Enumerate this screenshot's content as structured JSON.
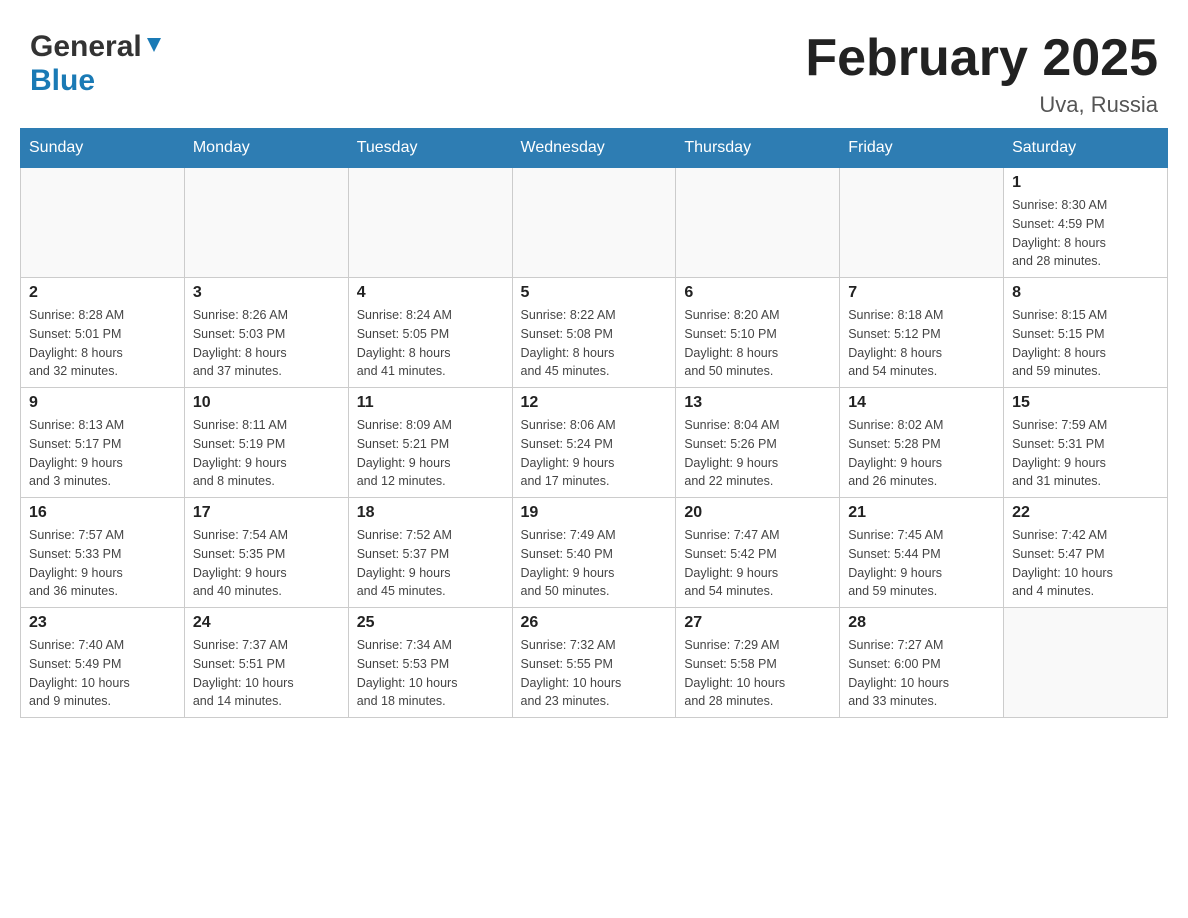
{
  "header": {
    "logo_general": "General",
    "logo_blue": "Blue",
    "title": "February 2025",
    "subtitle": "Uva, Russia"
  },
  "days_of_week": [
    "Sunday",
    "Monday",
    "Tuesday",
    "Wednesday",
    "Thursday",
    "Friday",
    "Saturday"
  ],
  "weeks": [
    [
      {
        "day": "",
        "info": ""
      },
      {
        "day": "",
        "info": ""
      },
      {
        "day": "",
        "info": ""
      },
      {
        "day": "",
        "info": ""
      },
      {
        "day": "",
        "info": ""
      },
      {
        "day": "",
        "info": ""
      },
      {
        "day": "1",
        "info": "Sunrise: 8:30 AM\nSunset: 4:59 PM\nDaylight: 8 hours\nand 28 minutes."
      }
    ],
    [
      {
        "day": "2",
        "info": "Sunrise: 8:28 AM\nSunset: 5:01 PM\nDaylight: 8 hours\nand 32 minutes."
      },
      {
        "day": "3",
        "info": "Sunrise: 8:26 AM\nSunset: 5:03 PM\nDaylight: 8 hours\nand 37 minutes."
      },
      {
        "day": "4",
        "info": "Sunrise: 8:24 AM\nSunset: 5:05 PM\nDaylight: 8 hours\nand 41 minutes."
      },
      {
        "day": "5",
        "info": "Sunrise: 8:22 AM\nSunset: 5:08 PM\nDaylight: 8 hours\nand 45 minutes."
      },
      {
        "day": "6",
        "info": "Sunrise: 8:20 AM\nSunset: 5:10 PM\nDaylight: 8 hours\nand 50 minutes."
      },
      {
        "day": "7",
        "info": "Sunrise: 8:18 AM\nSunset: 5:12 PM\nDaylight: 8 hours\nand 54 minutes."
      },
      {
        "day": "8",
        "info": "Sunrise: 8:15 AM\nSunset: 5:15 PM\nDaylight: 8 hours\nand 59 minutes."
      }
    ],
    [
      {
        "day": "9",
        "info": "Sunrise: 8:13 AM\nSunset: 5:17 PM\nDaylight: 9 hours\nand 3 minutes."
      },
      {
        "day": "10",
        "info": "Sunrise: 8:11 AM\nSunset: 5:19 PM\nDaylight: 9 hours\nand 8 minutes."
      },
      {
        "day": "11",
        "info": "Sunrise: 8:09 AM\nSunset: 5:21 PM\nDaylight: 9 hours\nand 12 minutes."
      },
      {
        "day": "12",
        "info": "Sunrise: 8:06 AM\nSunset: 5:24 PM\nDaylight: 9 hours\nand 17 minutes."
      },
      {
        "day": "13",
        "info": "Sunrise: 8:04 AM\nSunset: 5:26 PM\nDaylight: 9 hours\nand 22 minutes."
      },
      {
        "day": "14",
        "info": "Sunrise: 8:02 AM\nSunset: 5:28 PM\nDaylight: 9 hours\nand 26 minutes."
      },
      {
        "day": "15",
        "info": "Sunrise: 7:59 AM\nSunset: 5:31 PM\nDaylight: 9 hours\nand 31 minutes."
      }
    ],
    [
      {
        "day": "16",
        "info": "Sunrise: 7:57 AM\nSunset: 5:33 PM\nDaylight: 9 hours\nand 36 minutes."
      },
      {
        "day": "17",
        "info": "Sunrise: 7:54 AM\nSunset: 5:35 PM\nDaylight: 9 hours\nand 40 minutes."
      },
      {
        "day": "18",
        "info": "Sunrise: 7:52 AM\nSunset: 5:37 PM\nDaylight: 9 hours\nand 45 minutes."
      },
      {
        "day": "19",
        "info": "Sunrise: 7:49 AM\nSunset: 5:40 PM\nDaylight: 9 hours\nand 50 minutes."
      },
      {
        "day": "20",
        "info": "Sunrise: 7:47 AM\nSunset: 5:42 PM\nDaylight: 9 hours\nand 54 minutes."
      },
      {
        "day": "21",
        "info": "Sunrise: 7:45 AM\nSunset: 5:44 PM\nDaylight: 9 hours\nand 59 minutes."
      },
      {
        "day": "22",
        "info": "Sunrise: 7:42 AM\nSunset: 5:47 PM\nDaylight: 10 hours\nand 4 minutes."
      }
    ],
    [
      {
        "day": "23",
        "info": "Sunrise: 7:40 AM\nSunset: 5:49 PM\nDaylight: 10 hours\nand 9 minutes."
      },
      {
        "day": "24",
        "info": "Sunrise: 7:37 AM\nSunset: 5:51 PM\nDaylight: 10 hours\nand 14 minutes."
      },
      {
        "day": "25",
        "info": "Sunrise: 7:34 AM\nSunset: 5:53 PM\nDaylight: 10 hours\nand 18 minutes."
      },
      {
        "day": "26",
        "info": "Sunrise: 7:32 AM\nSunset: 5:55 PM\nDaylight: 10 hours\nand 23 minutes."
      },
      {
        "day": "27",
        "info": "Sunrise: 7:29 AM\nSunset: 5:58 PM\nDaylight: 10 hours\nand 28 minutes."
      },
      {
        "day": "28",
        "info": "Sunrise: 7:27 AM\nSunset: 6:00 PM\nDaylight: 10 hours\nand 33 minutes."
      },
      {
        "day": "",
        "info": ""
      }
    ]
  ]
}
